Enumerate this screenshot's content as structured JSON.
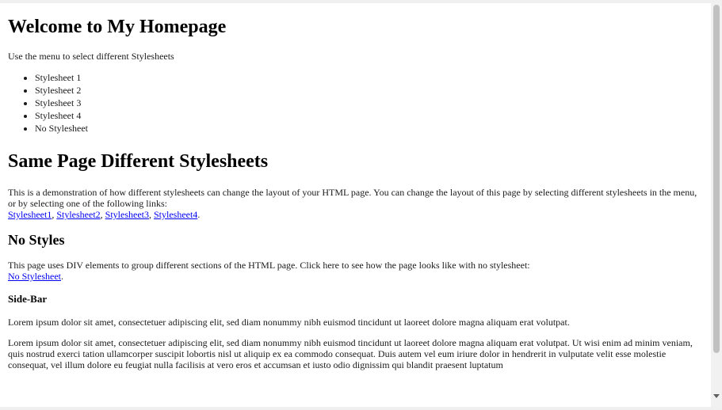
{
  "page": {
    "title": "Welcome to My Homepage",
    "intro": "Use the menu to select different Stylesheets",
    "menu": [
      "Stylesheet 1",
      "Stylesheet 2",
      "Stylesheet 3",
      "Stylesheet 4",
      "No Stylesheet"
    ]
  },
  "section_main": {
    "heading": "Same Page Different Stylesheets",
    "text": "This is a demonstration of how different stylesheets can change the layout of your HTML page. You can change the layout of this page by selecting different stylesheets in the menu, or by selecting one of the following links:",
    "links": [
      "Stylesheet1",
      "Stylesheet2",
      "Stylesheet3",
      "Stylesheet4"
    ],
    "sep": ", ",
    "end": "."
  },
  "section_nostyles": {
    "heading": "No Styles",
    "text": "This page uses DIV elements to group different sections of the HTML page. Click here to see how the page looks like with no stylesheet:",
    "link": "No Stylesheet",
    "end": "."
  },
  "section_sidebar": {
    "heading": "Side-Bar",
    "para1": "Lorem ipsum dolor sit amet, consectetuer adipiscing elit, sed diam nonummy nibh euismod tincidunt ut laoreet dolore magna aliquam erat volutpat.",
    "para2": "Lorem ipsum dolor sit amet, consectetuer adipiscing elit, sed diam nonummy nibh euismod tincidunt ut laoreet dolore magna aliquam erat volutpat. Ut wisi enim ad minim veniam, quis nostrud exerci tation ullamcorper suscipit lobortis nisl ut aliquip ex ea commodo consequat. Duis autem vel eum iriure dolor in hendrerit in vulputate velit esse molestie consequat, vel illum dolore eu feugiat nulla facilisis at vero eros et accumsan et iusto odio dignissim qui blandit praesent luptatum"
  },
  "colors": {
    "link": "#0000ee",
    "text": "#1a1a1a",
    "background": "#ffffff",
    "scrollbar_track": "#f1f1f1",
    "scrollbar_thumb": "#c1c1c1"
  },
  "icons": {
    "scroll_down": "chevron-down-icon"
  }
}
